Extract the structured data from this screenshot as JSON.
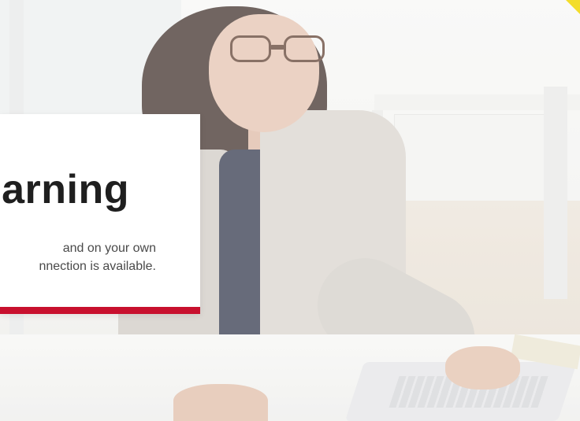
{
  "hero": {
    "card": {
      "title": "arning",
      "description_lines": [
        "and on your own",
        "nnection is available."
      ]
    }
  },
  "colors": {
    "accent_bar": "#c8102e",
    "corner_tag": "#f3dd2a",
    "card_background": "#ffffff"
  }
}
